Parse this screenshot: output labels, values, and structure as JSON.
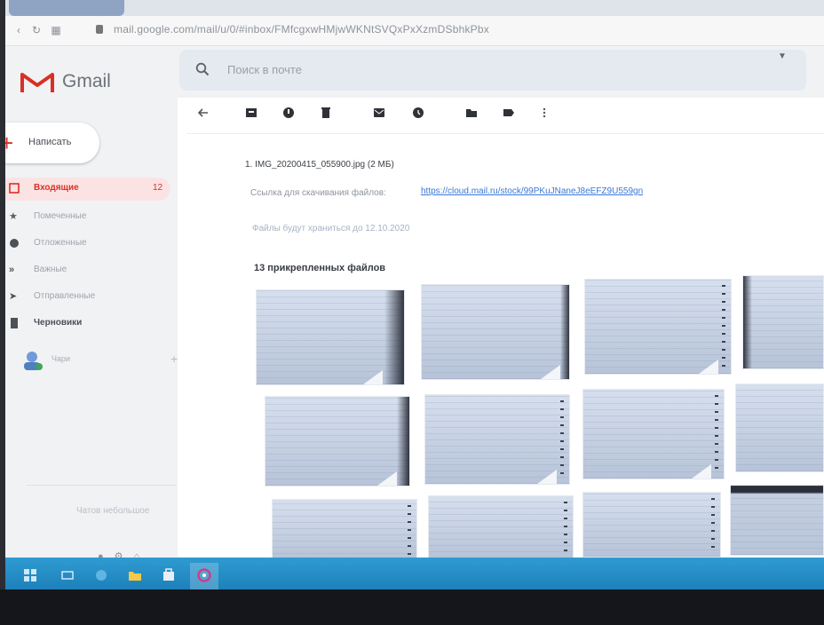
{
  "browser": {
    "url": "mail.google.com/mail/u/0/#inbox/FMfcgxwHMjwWKNtSVQxPxXzmDSbhkPbx"
  },
  "header": {
    "app_name": "Gmail",
    "search_placeholder": "Поиск в почте"
  },
  "sidebar": {
    "compose_label": "Написать",
    "items": [
      {
        "label": "Входящие",
        "icon": "inbox-icon",
        "count": "12"
      },
      {
        "label": "Помеченные",
        "icon": "star-icon"
      },
      {
        "label": "Отложенные",
        "icon": "clock-icon"
      },
      {
        "label": "Важные",
        "icon": "important-icon"
      },
      {
        "label": "Отправленные",
        "icon": "send-icon"
      },
      {
        "label": "Черновики",
        "icon": "draft-icon"
      }
    ],
    "chat_user": "Чари",
    "footer": "Чатов небольшое"
  },
  "toolbar": {
    "icons": [
      "back-icon",
      "archive-icon",
      "report-spam-icon",
      "delete-icon",
      "mark-unread-icon",
      "snooze-icon",
      "move-to-icon",
      "label-icon",
      "more-icon"
    ]
  },
  "message": {
    "attachment_line": "1. IMG_20200415_055900.jpg (2 МБ)",
    "download_label": "Ссылка для скачивания файлов:",
    "download_link": "https://cloud.mail.ru/stock/99PKuJNaneJ8eEFZ9U559gn",
    "keep_until": "Файлы будут храниться до 12.10.2020",
    "files_count": "13 прикрепленных файлов"
  },
  "colors": {
    "accent": "#d93025",
    "link": "#3a78d4",
    "taskbar": "#1c7fb9"
  }
}
